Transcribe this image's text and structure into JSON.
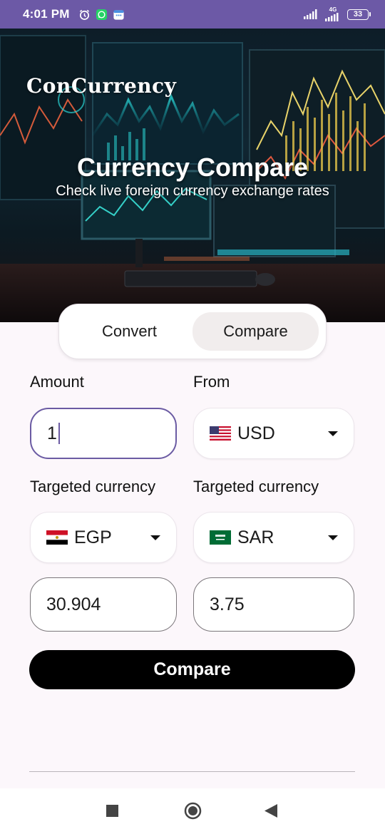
{
  "status_bar": {
    "time": "4:01 PM",
    "network": "4G",
    "battery": "33",
    "icons": [
      "alarm-icon",
      "whatsapp-icon",
      "calendar-icon",
      "signal-icon",
      "wifi-icon",
      "battery-icon"
    ]
  },
  "hero": {
    "logo": "ConCurrency",
    "title": "Currency Compare",
    "subtitle": "Check live foreign currency exchange rates"
  },
  "tabs": [
    {
      "label": "Convert",
      "active": false
    },
    {
      "label": "Compare",
      "active": true
    }
  ],
  "form": {
    "amount_label": "Amount",
    "amount_value": "1",
    "from_label": "From",
    "from_currency": "USD",
    "target1_label": "Targeted currency",
    "target1_currency": "EGP",
    "target2_label": "Targeted currency",
    "target2_currency": "SAR",
    "result1": "30.904",
    "result2": "3.75",
    "compare_button": "Compare"
  },
  "colors": {
    "status_bar": "#6c59a6",
    "accent": "#6b5ba3",
    "button": "#000000",
    "background": "#fcf7fb"
  },
  "nav": [
    "recents-square-icon",
    "home-circle-icon",
    "back-triangle-icon"
  ]
}
